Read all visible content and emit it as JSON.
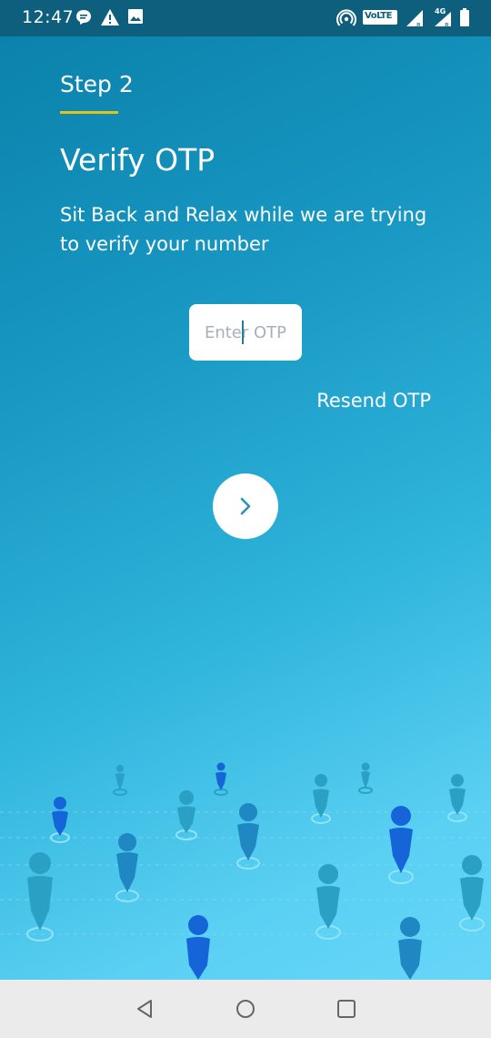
{
  "status_bar": {
    "time": "12:47",
    "left_icons": [
      "chat-bubble-icon",
      "warning-icon",
      "image-icon"
    ],
    "right_icons": [
      "hotspot-icon",
      "volte-badge-icon",
      "signal-icon",
      "signal-4g-icon",
      "battery-icon"
    ],
    "volte_text": "VoLTE",
    "network_text": "4G"
  },
  "main": {
    "step_label": "Step 2",
    "title": "Verify OTP",
    "subtitle": "Sit Back and Relax while we are trying to verify your number",
    "otp_placeholder": "Enter OTP",
    "otp_value": "",
    "resend_label": "Resend OTP",
    "next_icon": "chevron-right-icon"
  },
  "colors": {
    "status_bar": "#0e5e7e",
    "gradient_start": "#0b82ab",
    "gradient_end": "#66d6f8",
    "underline_accent": "#e3c317",
    "next_chevron": "#2a93b5"
  },
  "nav_bar": {
    "icons": [
      "back-icon",
      "home-icon",
      "recents-icon"
    ]
  }
}
